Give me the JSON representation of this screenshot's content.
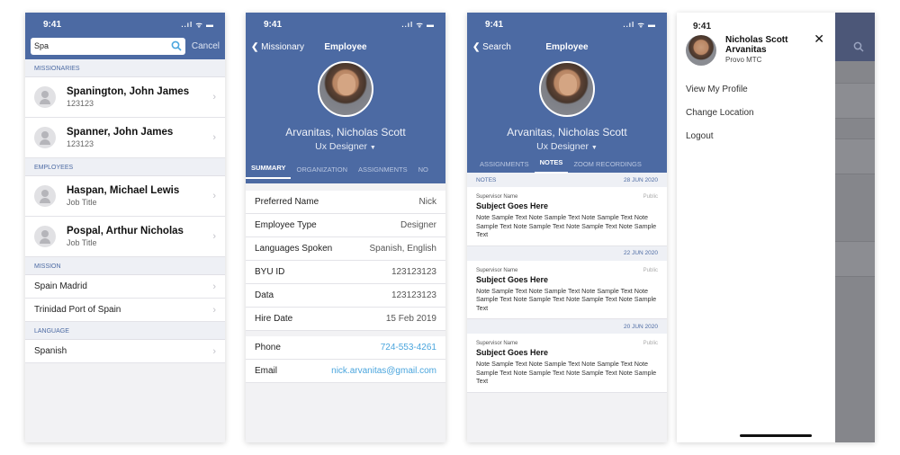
{
  "status": {
    "time": "9:41",
    "indicators": "..ıl ᯤ ▬"
  },
  "search_screen": {
    "query": "Spa",
    "cancel": "Cancel",
    "sections": {
      "missionaries": "MISSIONARIES",
      "employees": "EMPLOYEES",
      "mission": "MISSION",
      "language": "LANGUAGE"
    },
    "missionaries": [
      {
        "name": "Spanington, John James",
        "sub": "123123"
      },
      {
        "name": "Spanner, John James",
        "sub": "123123"
      }
    ],
    "employees": [
      {
        "name": "Haspan, Michael Lewis",
        "sub": "Job Title"
      },
      {
        "name": "Pospal, Arthur Nicholas",
        "sub": "Job Title"
      }
    ],
    "missions": [
      "Spain Madrid",
      "Trinidad Port of Spain"
    ],
    "languages": [
      "Spanish"
    ]
  },
  "employee_screen": {
    "back": "Missionary",
    "title": "Employee",
    "name": "Arvanitas, Nicholas Scott",
    "role": "Ux Designer",
    "tabs": [
      "SUMMARY",
      "ORGANIZATION",
      "ASSIGNMENTS",
      "NO"
    ],
    "rows": [
      {
        "label": "Preferred Name",
        "value": "Nick"
      },
      {
        "label": "Employee Type",
        "value": "Designer"
      },
      {
        "label": "Languages Spoken",
        "value": "Spanish, English"
      },
      {
        "label": "BYU ID",
        "value": "123123123"
      },
      {
        "label": "Data",
        "value": "123123123"
      },
      {
        "label": "Hire Date",
        "value": "15 Feb 2019"
      }
    ],
    "contact": [
      {
        "label": "Phone",
        "value": "724-553-4261"
      },
      {
        "label": "Email",
        "value": "nick.arvanitas@gmail.com"
      }
    ]
  },
  "notes_screen": {
    "back": "Search",
    "title": "Employee",
    "name": "Arvanitas, Nicholas Scott",
    "role": "Ux Designer",
    "tabs": [
      "ASSIGNMENTS",
      "NOTES",
      "ZOOM RECORDINGS"
    ],
    "notes_header": "NOTES",
    "notes": [
      {
        "date": "28 JUN 2020",
        "author": "Supervisor Name",
        "visibility": "Public",
        "subject": "Subject Goes Here",
        "text": "Note Sample Text Note Sample Text Note Sample Text Note Sample Text Note Sample Text Note Sample Text Note Sample Text"
      },
      {
        "date": "22 JUN 2020",
        "author": "Supervisor Name",
        "visibility": "Public",
        "subject": "Subject Goes Here",
        "text": "Note Sample Text Note Sample Text Note Sample Text Note Sample Text Note Sample Text Note Sample Text Note Sample Text"
      },
      {
        "date": "20 JUN 2020",
        "author": "Supervisor Name",
        "visibility": "Public",
        "subject": "Subject Goes Here",
        "text": "Note Sample Text Note Sample Text Note Sample Text Note Sample Text Note Sample Text Note Sample Text Note Sample Text"
      }
    ]
  },
  "menu_screen": {
    "name_line1": "Nicholas Scott",
    "name_line2": "Arvanitas",
    "location": "Provo MTC",
    "items": [
      "View My Profile",
      "Change Location",
      "Logout"
    ]
  },
  "icons": {
    "search": "search-icon",
    "close": "close-icon",
    "chevron": "chevron-right-icon",
    "back": "back-chevron-icon",
    "dropdown": "caret-down-icon"
  },
  "colors": {
    "primary": "#4c6aa3",
    "link": "#4aa5dd",
    "background": "#f2f2f4"
  }
}
